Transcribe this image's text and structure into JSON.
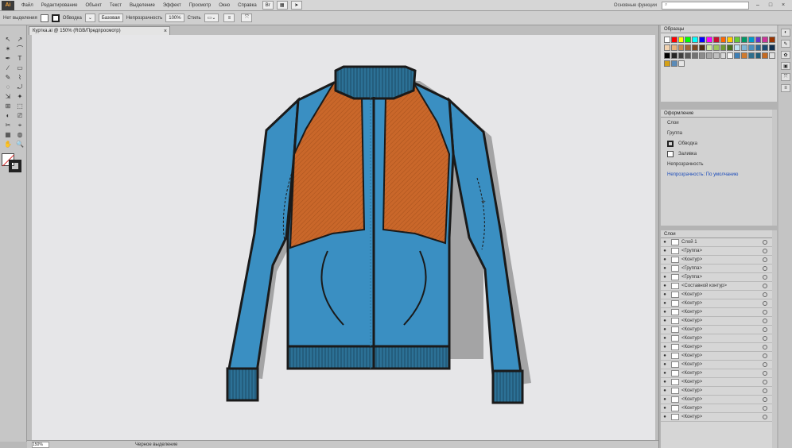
{
  "app": {
    "logo": "Ai"
  },
  "menu": [
    "Файл",
    "Редактирование",
    "Объект",
    "Текст",
    "Выделение",
    "Эффект",
    "Просмотр",
    "Окно",
    "Справка"
  ],
  "menubar_right": {
    "workspace": "Основные функции",
    "search_placeholder": ""
  },
  "window_controls": [
    "–",
    "□",
    "×"
  ],
  "control": {
    "selection_label": "Нет выделения",
    "stroke_label": "Обводка",
    "style_label": "Базовая",
    "opacity_label": "Непрозрачность",
    "opacity_value": "100%",
    "style_dd": "Стиль"
  },
  "document_tab": {
    "title": "Куртка.ai @ 150% (RGB/Предпросмотр)",
    "close": "×"
  },
  "tools": [
    "↖",
    "↗",
    "✶",
    "⌒",
    "✒",
    "T",
    "∕",
    "▭",
    "✎",
    "⌇",
    "◌",
    "⤾",
    "⇲",
    "✦",
    "⊞",
    "⬚",
    "◐",
    "⎚",
    "✂",
    "⌖",
    "▦",
    "◍",
    "✋",
    "🔍"
  ],
  "status": {
    "zoom": "150%",
    "text": "Черное выделение"
  },
  "swatches": {
    "title": "Образцы",
    "rows": [
      [
        "#ffffff",
        "#ff0000",
        "#ffff00",
        "#00ff00",
        "#00ffff",
        "#0000ff",
        "#ff00ff",
        "#c8102e",
        "#ff6600",
        "#ffcc00",
        "#66cc33",
        "#009966",
        "#0099cc",
        "#6633cc",
        "#cc3399",
        "#993300"
      ],
      [
        "#f2d3b0",
        "#e8b27c",
        "#c98b4f",
        "#a0673a",
        "#7a4a24",
        "#4f2d13",
        "#cfe7a2",
        "#9cc45c",
        "#6f9a34",
        "#47701d",
        "#bfe0f0",
        "#7fb6d6",
        "#4a8fbf",
        "#2b6a9a",
        "#1d4a73",
        "#0f2f4f"
      ],
      [
        "#000000",
        "#262626",
        "#404040",
        "#595959",
        "#737373",
        "#8c8c8c",
        "#a6a6a6",
        "#bfbfbf",
        "#d9d9d9",
        "#f2f2f2",
        "#3d7fb5",
        "#d07a2e",
        "#2e6f8e",
        "#1f5f7a",
        "#c46a22",
        "#e0e0e0"
      ],
      [
        "#d4a017",
        "#5b8bb8",
        "#e6e6e6"
      ]
    ]
  },
  "appearance": {
    "title": "Оформление",
    "rows": [
      "Слои",
      "Группа",
      "Обводка",
      "Заливка",
      "Непрозрачность"
    ],
    "link_row": "Непрозрачность: По умолчанию"
  },
  "layers": {
    "title": "Слои",
    "rows": [
      "Слой 1",
      "<Группа>",
      "<Контур>",
      "<Группа>",
      "<Группа>",
      "<Составной контур>",
      "<Контур>",
      "<Контур>",
      "<Контур>",
      "<Контур>",
      "<Контур>",
      "<Контур>",
      "<Контур>",
      "<Контур>",
      "<Контур>",
      "<Контур>",
      "<Контур>",
      "<Контур>",
      "<Контур>",
      "<Контур>",
      "<Контур>"
    ]
  },
  "colors": {
    "jacket_blue": "#3a8fc2",
    "jacket_orange": "#c9672a",
    "rib_blue": "#2c7196",
    "outline": "#1a1a1a"
  }
}
